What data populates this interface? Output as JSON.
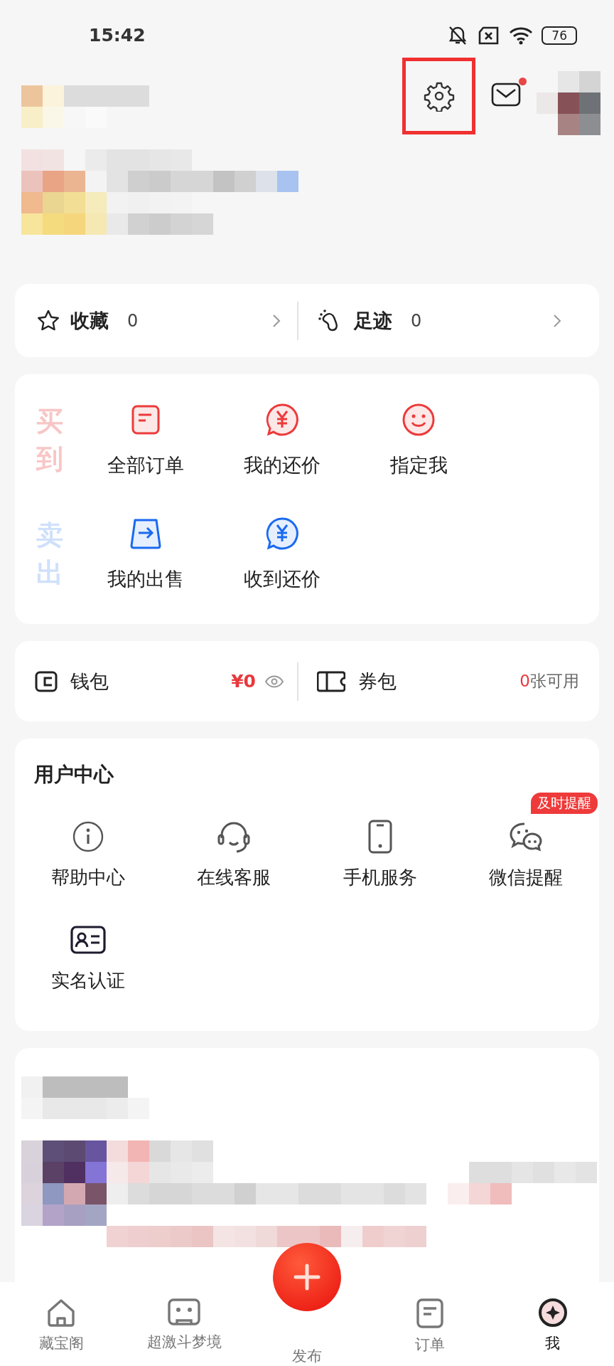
{
  "status_bar": {
    "time": "15:42",
    "battery": "76"
  },
  "header": {
    "settings_highlighted": true,
    "mail_unread": true
  },
  "quick_links": [
    {
      "label": "收藏",
      "count": "0"
    },
    {
      "label": "足迹",
      "count": "0"
    }
  ],
  "trade_groups": [
    {
      "kind": "buy",
      "title": "买到",
      "items": [
        {
          "label": "全部订单"
        },
        {
          "label": "我的还价"
        },
        {
          "label": "指定我"
        }
      ]
    },
    {
      "kind": "sell",
      "title": "卖出",
      "items": [
        {
          "label": "我的出售"
        },
        {
          "label": "收到还价"
        }
      ]
    }
  ],
  "wallet": {
    "label": "钱包",
    "amount": "¥0"
  },
  "coupons": {
    "label": "券包",
    "count": "0",
    "suffix": "张可用"
  },
  "user_center": {
    "title": "用户中心",
    "items": [
      {
        "label": "帮助中心"
      },
      {
        "label": "在线客服"
      },
      {
        "label": "手机服务"
      },
      {
        "label": "微信提醒",
        "badge": "及时提醒"
      },
      {
        "label": "实名认证"
      }
    ]
  },
  "bottom_nav": [
    {
      "kind": "tab",
      "label": "藏宝阁",
      "selected": false
    },
    {
      "kind": "tab",
      "label": "超激斗梦境",
      "selected": false
    },
    {
      "kind": "publish",
      "label": "发布"
    },
    {
      "kind": "tab",
      "label": "订单",
      "selected": false
    },
    {
      "kind": "tab",
      "label": "我",
      "selected": true
    }
  ]
}
